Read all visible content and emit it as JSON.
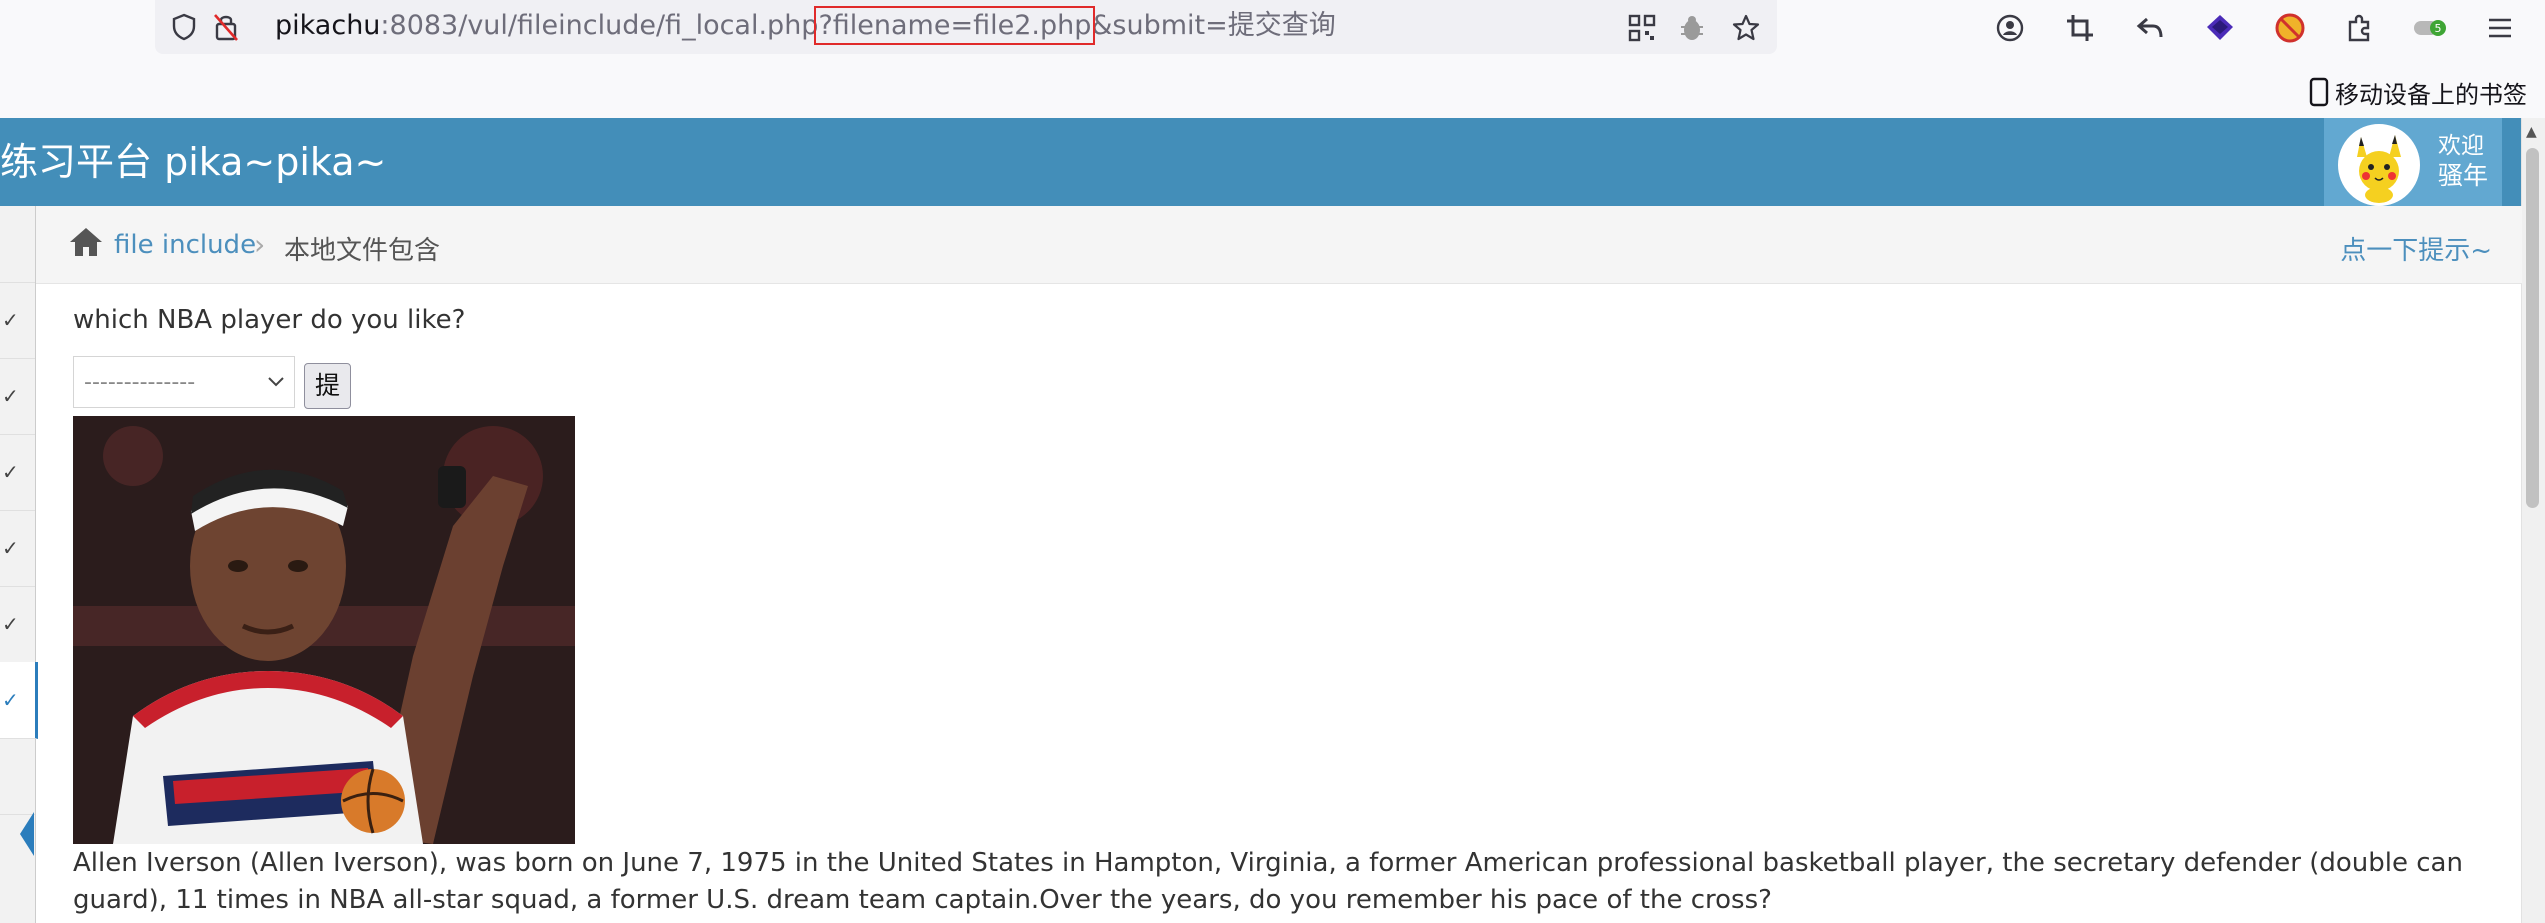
{
  "browser": {
    "url_host": "pikachu",
    "url_path": ":8083/vul/fileinclude/fi_local.php",
    "url_highlight": "?filename=file2.php",
    "url_tail": "&submit=提交查询",
    "badge": "5",
    "bookmark_label": "移动设备上的书签"
  },
  "navbar": {
    "brand": "练习平台 pika~pika~",
    "welcome_line1": "欢迎",
    "welcome_line2": "骚年"
  },
  "breadcrumb": {
    "item1": "file include",
    "separator": "›",
    "item2": "本地文件包含",
    "hint": "点一下提示~"
  },
  "main": {
    "question": "which NBA player do you like?",
    "select_value": "--------------",
    "submit_label": "提交查询",
    "description": "Allen Iverson (Allen Iverson), was born on June 7, 1975 in the United States in Hampton, Virginia, a former American professional basketball player, the secretary defender (double can guard), 11 times in NBA all-star squad, a former U.S. dream team captain.Over the years, do you remember his pace of the cross?"
  },
  "sidebar": {
    "check": "✓"
  },
  "colors": {
    "navbar": "#438eb9",
    "userbox": "#62a8d1",
    "link": "#4c8fbd",
    "highlight_border": "#e02a2a"
  }
}
